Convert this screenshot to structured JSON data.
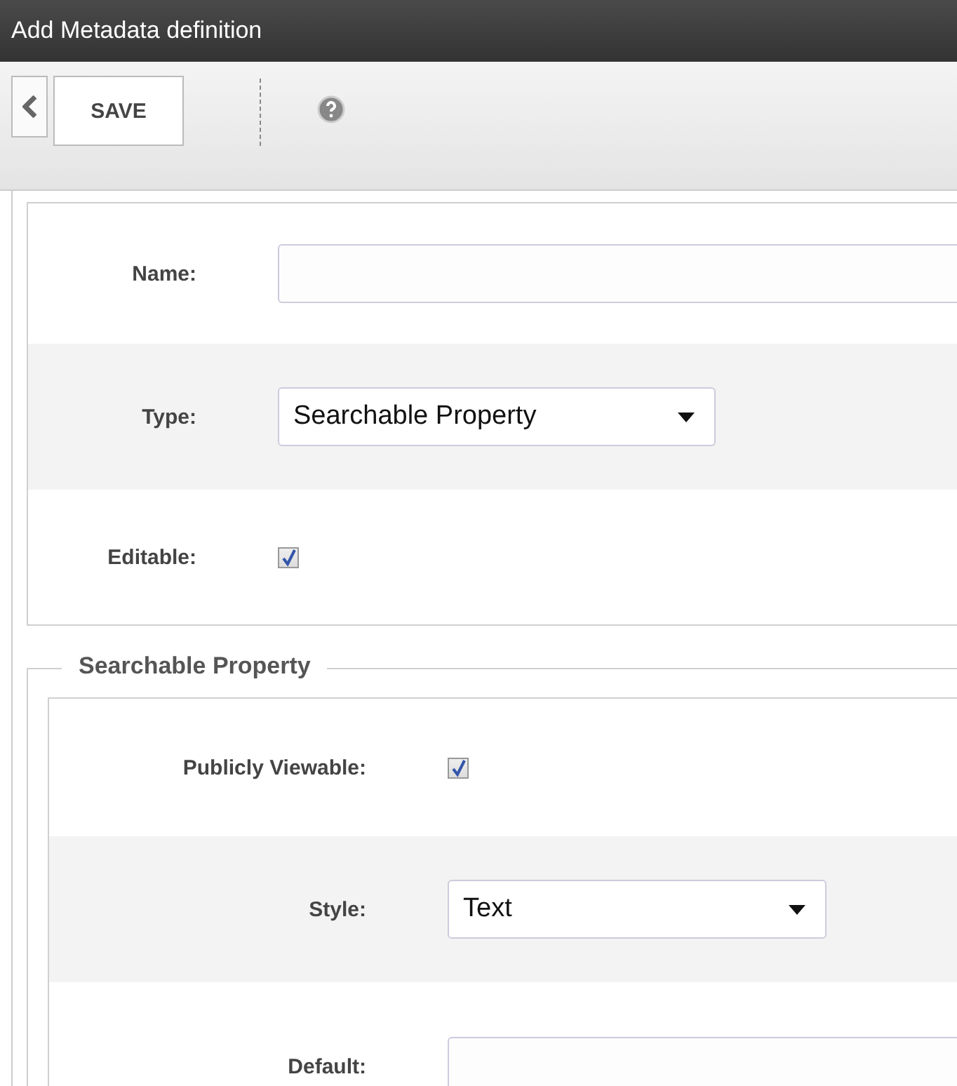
{
  "window": {
    "title": "Add Metadata definition"
  },
  "toolbar": {
    "save_label": "SAVE"
  },
  "fields": [
    {
      "kind": "text",
      "label": "Name:"
    },
    {
      "kind": "select",
      "label": "Type:",
      "value": "Searchable Property"
    },
    {
      "kind": "checkbox",
      "label": "Editable:",
      "checked": true
    }
  ],
  "searchable_property": {
    "legend": "Searchable Property",
    "fields": [
      {
        "kind": "checkbox",
        "label": "Publicly Viewable:",
        "checked": true
      },
      {
        "kind": "select",
        "label": "Style:",
        "value": "Text"
      },
      {
        "kind": "text",
        "label": "Default:"
      }
    ]
  }
}
